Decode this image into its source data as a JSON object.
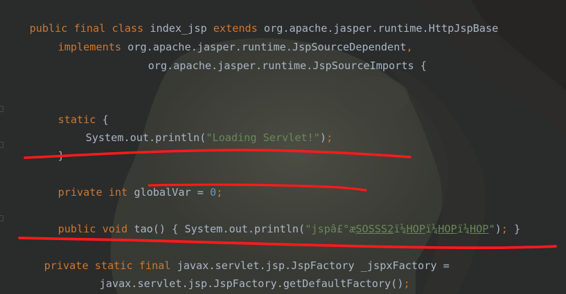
{
  "code": {
    "l1": {
      "kw1": "public final class",
      "name": " index_jsp ",
      "kw2": "extends",
      "rest": " org.apache.jasper.runtime.HttpJspBase"
    },
    "l2": {
      "kw": "implements",
      "rest": " org.apache.jasper.runtime.JspSourceDependent",
      "sep": ","
    },
    "l3": {
      "rest": "org.apache.jasper.runtime.JspSourceImports {"
    },
    "l4": {
      "kw": "static",
      "rest": " {"
    },
    "l5": {
      "pre": "System.out.println(",
      "str": "\"Loading Servlet!\"",
      "post": ")",
      "semi": ";"
    },
    "l6": {
      "rest": "}"
    },
    "l7": {
      "kw": "private int",
      "rest": " globalVar = ",
      "num": "0",
      "semi": ";"
    },
    "l8": {
      "kw": "public void",
      "pre": " tao() { System.out.println(",
      "str1": "\"jspâ£°æ",
      "str2": "SOSSS2",
      "str3": "ï¼",
      "str4": "HOP",
      "str5": "ï¼",
      "str6": "HOP",
      "str7": "ï¼",
      "str8": "HOP",
      "str9": "\"",
      "post": ")",
      "semi": ";",
      "end": " }"
    },
    "l9": {
      "kw": "private static final",
      "rest": " javax.servlet.jsp.JspFactory _jspxFactory ="
    },
    "l10": {
      "rest": "javax.servlet.jsp.JspFactory.getDefaultFactory()",
      "semi": ";"
    }
  },
  "colors": {
    "keyword": "#cc7832",
    "text": "#a9b7c6",
    "string": "#6a8759",
    "number": "#6897bb",
    "annotation": "#ff1a1a",
    "background": "#2a2b2b"
  }
}
